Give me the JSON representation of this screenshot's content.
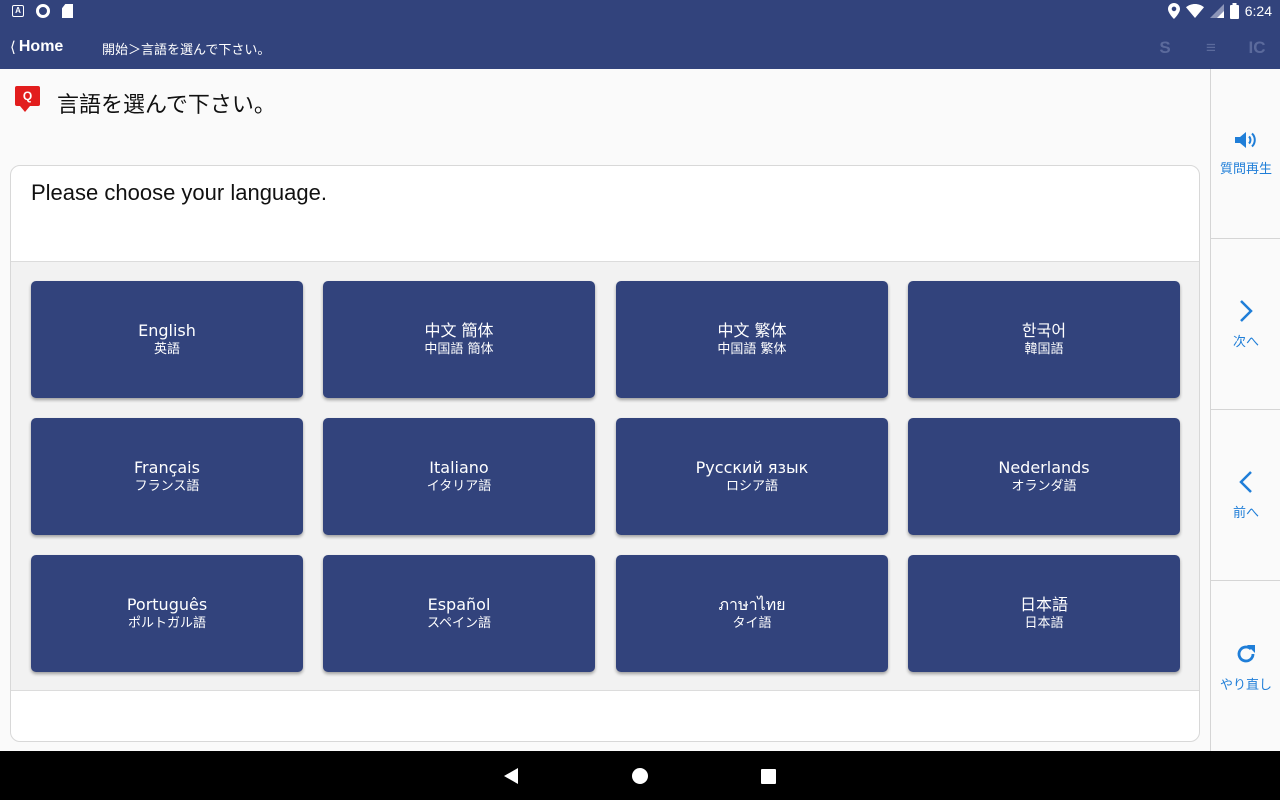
{
  "status_bar": {
    "time": "6:24",
    "icons": [
      "keyboard-a-icon",
      "circle-icon",
      "sd-card-icon",
      "location-icon",
      "wifi-icon",
      "signal-icon",
      "battery-icon"
    ]
  },
  "app_bar": {
    "back_chevron": "⟨",
    "home_label": "Home",
    "breadcrumb": "開始＞言語を選んで下さい。",
    "actions": [
      "S",
      "≡",
      "IC"
    ]
  },
  "question": {
    "badge": "Q",
    "title": "言語を選んで下さい。",
    "prompt": "Please choose your language."
  },
  "languages": [
    {
      "name": "English",
      "sub": "英語"
    },
    {
      "name": "中文 簡体",
      "sub": "中国語 簡体"
    },
    {
      "name": "中文 繁体",
      "sub": "中国語 繁体"
    },
    {
      "name": "한국어",
      "sub": "韓国語"
    },
    {
      "name": "Français",
      "sub": "フランス語"
    },
    {
      "name": "Italiano",
      "sub": "イタリア語"
    },
    {
      "name": "Русский язык",
      "sub": "ロシア語"
    },
    {
      "name": "Nederlands",
      "sub": "オランダ語"
    },
    {
      "name": "Português",
      "sub": "ポルトガル語"
    },
    {
      "name": "Español",
      "sub": "スペイン語"
    },
    {
      "name": "ภาษาไทย",
      "sub": "タイ語"
    },
    {
      "name": "日本語",
      "sub": "日本語"
    }
  ],
  "rail": {
    "replay_label": "質問再生",
    "next_label": "次へ",
    "prev_label": "前へ",
    "redo_label": "やり直し"
  },
  "colors": {
    "primary": "#32437c",
    "accent": "#1f7ed8",
    "badge": "#e21d1d"
  }
}
